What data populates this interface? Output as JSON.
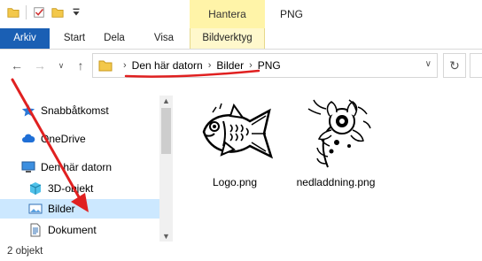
{
  "quick_access": {
    "icons": [
      "folder-icon",
      "checkmark-properties-icon",
      "new-folder-icon",
      "customize-quick-access-icon"
    ]
  },
  "context_tab_group": "Hantera",
  "window_title": "PNG",
  "ribbon": {
    "tabs": [
      "Arkiv",
      "Start",
      "Dela",
      "Visa",
      "Bildverktyg"
    ]
  },
  "address": {
    "path": [
      "Den här datorn",
      "Bilder",
      "PNG"
    ]
  },
  "sidebar": {
    "items": [
      {
        "label": "Snabbåtkomst",
        "icon": "star-icon"
      },
      {
        "label": "OneDrive",
        "icon": "cloud-icon"
      },
      {
        "label": "Den här datorn",
        "icon": "computer-icon"
      },
      {
        "label": "3D-objekt",
        "icon": "cube-icon"
      },
      {
        "label": "Bilder",
        "icon": "pictures-icon",
        "selected": true
      },
      {
        "label": "Dokument",
        "icon": "document-icon"
      }
    ]
  },
  "files": [
    {
      "name": "Logo.png",
      "thumbnail": "fish-drawing-thumbnail"
    },
    {
      "name": "nedladdning.png",
      "thumbnail": "flower-drawing-thumbnail"
    }
  ],
  "status": "2 objekt",
  "colors": {
    "accent": "#1a5fb4",
    "context_tab": "#fff4a8",
    "selection": "#cce8ff",
    "annotation": "#e02020"
  }
}
